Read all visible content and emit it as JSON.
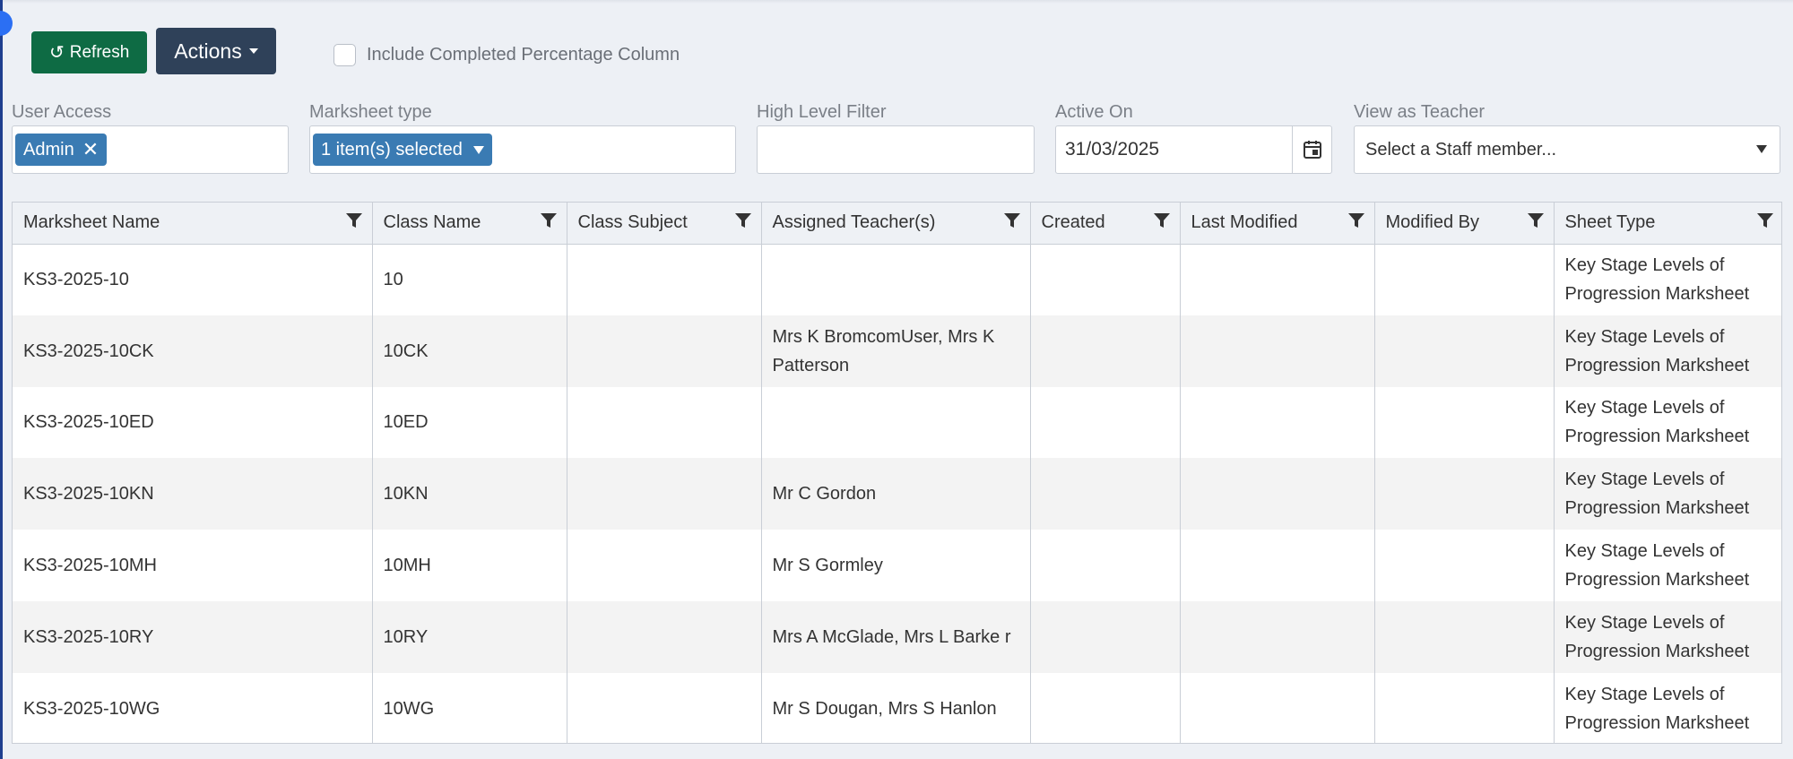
{
  "toolbar": {
    "refresh_label": "Refresh",
    "actions_label": "Actions",
    "include_completed_label": "Include Completed Percentage Column"
  },
  "filters": {
    "user_access": {
      "label": "User Access",
      "chip": "Admin"
    },
    "marksheet_type": {
      "label": "Marksheet type",
      "chip": "1 item(s) selected"
    },
    "high_level": {
      "label": "High Level Filter",
      "value": ""
    },
    "active_on": {
      "label": "Active On",
      "value": "31/03/2025"
    },
    "view_as_teacher": {
      "label": "View as Teacher",
      "placeholder": "Select a Staff member..."
    }
  },
  "grid": {
    "columns": [
      "Marksheet Name",
      "Class Name",
      "Class Subject",
      "Assigned Teacher(s)",
      "Created",
      "Last Modified",
      "Modified By",
      "Sheet Type"
    ],
    "rows": [
      [
        "KS3-2025-10",
        "10",
        "",
        "",
        "",
        "",
        "",
        "Key Stage Levels of Progression Marksheet"
      ],
      [
        "KS3-2025-10CK",
        "10CK",
        "",
        "Mrs K BromcomUser, Mrs K Patterson",
        "",
        "",
        "",
        "Key Stage Levels of Progression Marksheet"
      ],
      [
        "KS3-2025-10ED",
        "10ED",
        "",
        "",
        "",
        "",
        "",
        "Key Stage Levels of Progression Marksheet"
      ],
      [
        "KS3-2025-10KN",
        "10KN",
        "",
        "Mr C Gordon",
        "",
        "",
        "",
        "Key Stage Levels of Progression Marksheet"
      ],
      [
        "KS3-2025-10MH",
        "10MH",
        "",
        "Mr S Gormley",
        "",
        "",
        "",
        "Key Stage Levels of Progression Marksheet"
      ],
      [
        "KS3-2025-10RY",
        "10RY",
        "",
        "Mrs A McGlade, Mrs L Barke r",
        "",
        "",
        "",
        "Key Stage Levels of Progression Marksheet"
      ],
      [
        "KS3-2025-10WG",
        "10WG",
        "",
        "Mr S Dougan, Mrs S Hanlon",
        "",
        "",
        "",
        "Key Stage Levels of Progression Marksheet"
      ]
    ]
  }
}
